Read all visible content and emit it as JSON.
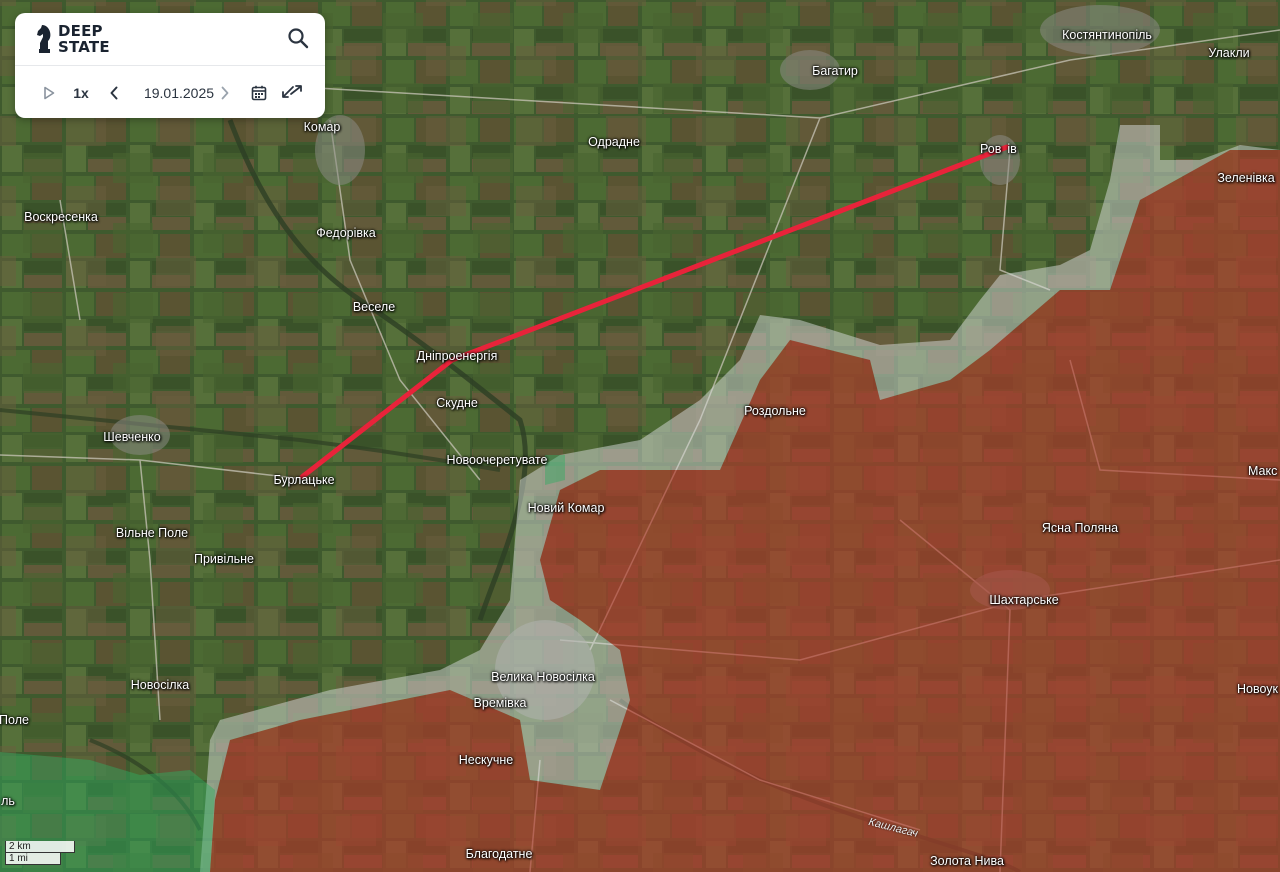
{
  "app": {
    "logo_line1": "DEEP",
    "logo_line2": "STATE"
  },
  "toolbar": {
    "play_icon": "play-icon",
    "speed": "1x",
    "prev_icon": "chevron-left-icon",
    "date": "19.01.2025",
    "next_icon": "chevron-right-icon",
    "calendar_icon": "calendar-icon",
    "compare_icon": "compare-arrows-icon",
    "search_icon": "search-icon"
  },
  "colors": {
    "occupied": "#b8392c",
    "gray_zone": "#c8d0d0",
    "liberated": "#2fae62",
    "front_line": "#e8233a"
  },
  "places": {
    "kostiantynopil": "Костянтинопіль",
    "ulakly": "Улакли",
    "bahatyr": "Багатир",
    "komar": "Комар",
    "odradne": "Одрадне",
    "rozdolne_top": "Ров",
    "rozdolne_top_end": "ів",
    "zelenivka": "Зеленівка",
    "voskresenka": "Воскресенка",
    "fedorivka": "Федорівка",
    "vesele": "Веселе",
    "dniproenerhiia": "Дніпроенергія",
    "skudne": "Скудне",
    "rozdolne": "Роздольне",
    "shevchenko": "Шевченко",
    "novoocheretuvate": "Новоочеретувате",
    "maks": "Макс",
    "burlatske": "Бурлацьке",
    "novyi_komar": "Новий Комар",
    "yasna_poliana": "Ясна Поляна",
    "vilne_pole": "Вільне Поле",
    "pryvilne": "Привільне",
    "shakhtarske": "Шахтарське",
    "velyka_novosilka": "Велика Новосілка",
    "novoukr": "Новоук",
    "novosilka": "Новосілка",
    "vremivka": "Времівка",
    "pole": "Поле",
    "neskuchne": "Нескучне",
    "l": "ль",
    "blahodatne": "Благодатне",
    "zolota_nyva": "Золота Нива"
  },
  "river": {
    "kashlahach": "Кашлагач"
  },
  "scale": {
    "km": "2 km",
    "mi": "1 mi"
  }
}
